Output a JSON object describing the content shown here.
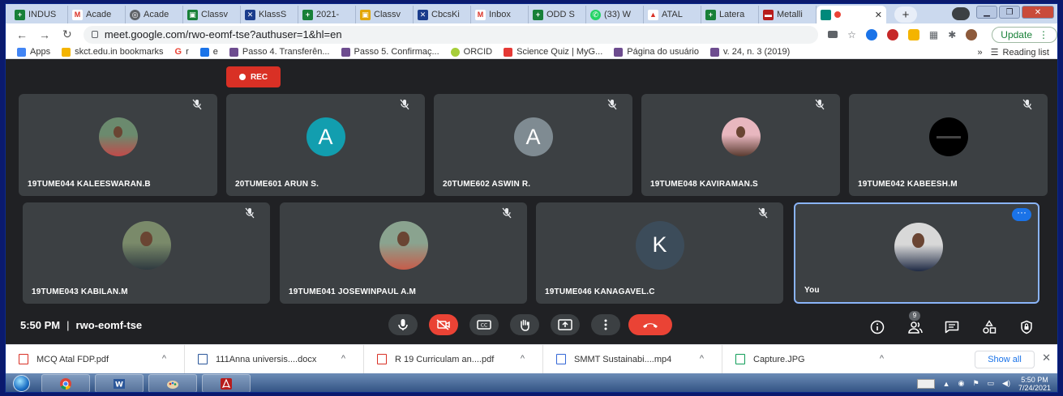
{
  "browser": {
    "tabs": [
      {
        "label": "INDUS",
        "fav_color": "#188038",
        "fav_glyph": "+"
      },
      {
        "label": "Acade",
        "fav_color": "#ffffff",
        "fav_glyph": "M"
      },
      {
        "label": "Acade",
        "fav_color": "#5f6368",
        "fav_glyph": "◎"
      },
      {
        "label": "Classv",
        "fav_color": "#188038",
        "fav_glyph": "▣"
      },
      {
        "label": "KlassS",
        "fav_color": "#1a3c8c",
        "fav_glyph": "✕"
      },
      {
        "label": "2021-",
        "fav_color": "#188038",
        "fav_glyph": "+"
      },
      {
        "label": "Classv",
        "fav_color": "#e3a600",
        "fav_glyph": "▣"
      },
      {
        "label": "CbcsKi",
        "fav_color": "#1a3c8c",
        "fav_glyph": "✕"
      },
      {
        "label": "Inbox",
        "fav_color": "#ffffff",
        "fav_glyph": "M"
      },
      {
        "label": "ODD S",
        "fav_color": "#188038",
        "fav_glyph": "+"
      },
      {
        "label": "(33) W",
        "fav_color": "#25d366",
        "fav_glyph": "✆"
      },
      {
        "label": "ATAL",
        "fav_color": "#ffffff",
        "fav_glyph": "▲"
      },
      {
        "label": "Latera",
        "fav_color": "#188038",
        "fav_glyph": "+"
      },
      {
        "label": "Metalli",
        "fav_color": "#b71c1c",
        "fav_glyph": "▬"
      }
    ],
    "active_tab_close": "✕",
    "new_tab": "+",
    "url": "meet.google.com/rwo-eomf-tse?authuser=1&hl=en",
    "update_label": "Update",
    "bookmarks": [
      {
        "label": "Apps",
        "color": "#4285f4"
      },
      {
        "label": "skct.edu.in bookmarks",
        "color": "#f4b400"
      },
      {
        "label": "r",
        "color": "#ea4335"
      },
      {
        "label": "e",
        "color": "#1a73e8"
      },
      {
        "label": "Passo 4. Transferên...",
        "color": "#6d4c8f"
      },
      {
        "label": "Passo 5. Confirmaç...",
        "color": "#6d4c8f"
      },
      {
        "label": "ORCID",
        "color": "#a6ce39"
      },
      {
        "label": "Science Quiz | MyG...",
        "color": "#e53935"
      },
      {
        "label": "Página do usuário",
        "color": "#6d4c8f"
      },
      {
        "label": "v. 24, n. 3 (2019)",
        "color": "#6d4c8f"
      }
    ],
    "bookmark_g": "G",
    "reading_list": "Reading list",
    "overflow": "»"
  },
  "meeting": {
    "rec_label": "REC",
    "time": "5:50 PM",
    "separator": "|",
    "code": "rwo-eomf-tse",
    "participant_badge": "9",
    "row1": [
      {
        "name": "19TUME044 KALEESWARAN.B",
        "type": "photo",
        "colors": [
          "#6b8a6e",
          "#c24a4a"
        ]
      },
      {
        "name": "20TUME601 ARUN S.",
        "type": "letter",
        "letter": "A",
        "color": "#129eaf"
      },
      {
        "name": "20TUME602 ASWIN R.",
        "type": "letter",
        "letter": "A",
        "color": "#7f8b92"
      },
      {
        "name": "19TUME048 KAVIRAMAN.S",
        "type": "photo",
        "colors": [
          "#e8b7bf",
          "#5a3b30"
        ]
      },
      {
        "name": "19TUME042 KABEESH.M",
        "type": "dark",
        "colors": [
          "#000000",
          "#444444"
        ]
      }
    ],
    "row2": [
      {
        "name": "19TUME043 KABILAN.M",
        "type": "photo",
        "colors": [
          "#7a8a6a",
          "#2f3a40"
        ]
      },
      {
        "name": "19TUME041 JOSEWINPAUL A.M",
        "type": "photo",
        "colors": [
          "#8aa38f",
          "#c65c4a"
        ]
      },
      {
        "name": "19TUME046 KANAGAVEL.C",
        "type": "letter",
        "letter": "K",
        "color": "#3c4c5a"
      },
      {
        "name": "You",
        "type": "photo",
        "colors": [
          "#d8d8d8",
          "#1f2a44"
        ]
      }
    ]
  },
  "downloads": {
    "items": [
      {
        "label": "MCQ Atal FDP.pdf",
        "color": "#d93025"
      },
      {
        "label": "111Anna universis....docx",
        "color": "#2b579a"
      },
      {
        "label": "R 19 Curriculam an....pdf",
        "color": "#d93025"
      },
      {
        "label": "SMMT Sustainabi....mp4",
        "color": "#3367d6"
      },
      {
        "label": "Capture.JPG",
        "color": "#0f9d58"
      }
    ],
    "chevron": "^",
    "show_all": "Show all",
    "close": "✕"
  },
  "taskbar": {
    "time": "5:50 PM",
    "date": "7/24/2021"
  }
}
